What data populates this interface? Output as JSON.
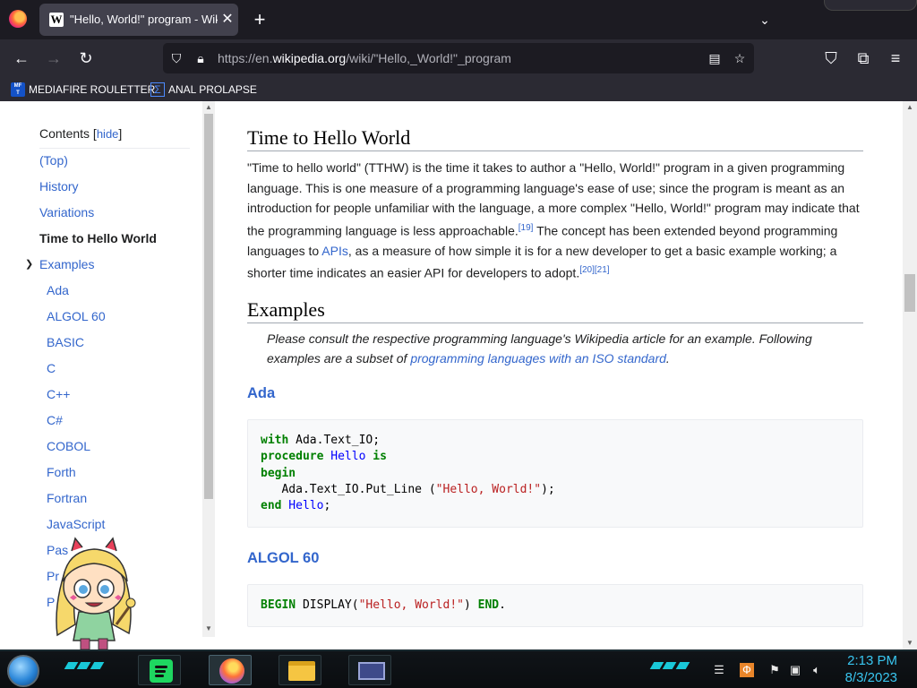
{
  "browser": {
    "tab_title": "\"Hello, World!\" program - Wikipedia",
    "tab_close": "✕",
    "new_tab": "+",
    "tab_list": "⌄",
    "url_prefix": "https://en.",
    "url_domain": "wikipedia.org",
    "url_path": "/wiki/\"Hello,_World!\"_program",
    "bookmarks": [
      {
        "label": "MEDIAFIRE ROULETTER",
        "icon": "mediafire-icon"
      },
      {
        "label": "ANAL PROLAPSE",
        "icon": "sigma-icon"
      }
    ]
  },
  "toc": {
    "title": "Contents",
    "hide_label": "hide",
    "items": [
      {
        "label": "(Top)"
      },
      {
        "label": "History"
      },
      {
        "label": "Variations"
      },
      {
        "label": "Time to Hello World"
      },
      {
        "label": "Examples"
      },
      {
        "label": "Ada"
      },
      {
        "label": "ALGOL 60"
      },
      {
        "label": "BASIC"
      },
      {
        "label": "C"
      },
      {
        "label": "C++"
      },
      {
        "label": "C#"
      },
      {
        "label": "COBOL"
      },
      {
        "label": "Forth"
      },
      {
        "label": "Fortran"
      },
      {
        "label": "JavaScript"
      },
      {
        "label": "Pas"
      },
      {
        "label": "Pr"
      },
      {
        "label": "P"
      }
    ]
  },
  "article": {
    "section1_title": "Time to Hello World",
    "p1_a": "\"Time to hello world\" (TTHW) is the time it takes to author a \"Hello, World!\" program in a given programming language. This is one measure of a programming language's ease of use; since the program is meant as an introduction for people unfamiliar with the language, a more complex \"Hello, World!\" program may indicate that the programming language is less approachable.",
    "ref19": "[19]",
    "p1_b": " The concept has been extended beyond programming languages to ",
    "apis_link": "APIs",
    "p1_c": ", as a measure of how simple it is for a new developer to get a basic example working; a shorter time indicates an easier API for developers to adopt.",
    "ref20": "[20]",
    "ref21": "[21]",
    "section2_title": "Examples",
    "hatnote_a": "Please consult the respective programming language's Wikipedia article for an example. Following examples are a subset of ",
    "hatnote_link": "programming languages with an ISO standard",
    "hatnote_b": ".",
    "ada_title": "Ada",
    "ada_code": {
      "l1_kw": "with",
      "l1_rest": " Ada.Text_IO;",
      "l2_kw": "procedure",
      "l2_name": " Hello",
      "l2_kw2": " is",
      "l3_kw": "begin",
      "l4_rest": "   Ada.Text_IO.Put_Line (",
      "l4_str": "\"Hello, World!\"",
      "l4_end": ");",
      "l5_kw": "end",
      "l5_name": " Hello",
      "l5_end": ";"
    },
    "algol_title": "ALGOL 60",
    "algol_code": {
      "kw1": "BEGIN",
      "mid": " DISPLAY(",
      "str": "\"Hello, World!\"",
      "end1": ") ",
      "kw2": "END",
      "end2": "."
    }
  },
  "taskbar": {
    "time": "2:13 PM",
    "date": "8/3/2023"
  },
  "colors": {
    "link": "#3366cc",
    "clock": "#39c6f0",
    "code_bg": "#f8f9fa"
  }
}
